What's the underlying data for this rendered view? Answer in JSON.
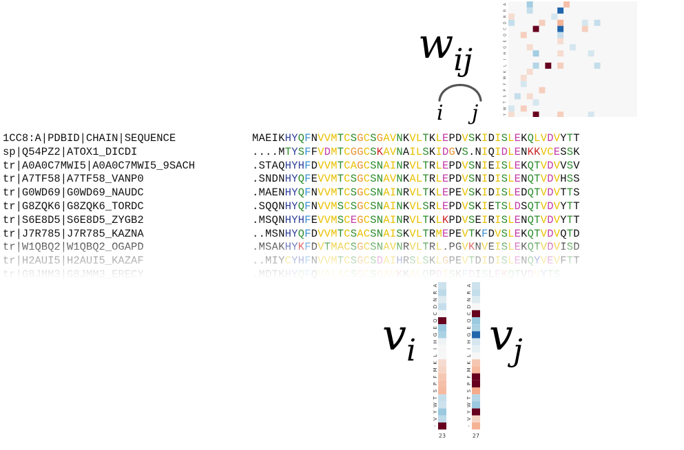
{
  "msa": {
    "rows": [
      {
        "id": "1CC8:A|PDBID|CHAIN|SEQUENCE",
        "seq": "MAEIKHYQFNVVMTCSGCSGAVNKVLTKLEPDVSKIDISLEKQLVDVYTT"
      },
      {
        "id": "sp|Q54PZ2|ATOX1_DICDI",
        "seq": "....MTYSFFVDMTCGGCSKAVNAILSKIDGVS.NIQIDLENKKVCESSK"
      },
      {
        "id": "tr|A0A0C7MWI5|A0A0C7MWI5_9SACH",
        "seq": ".STAQHYHFDVVMTCAGCSNAINRVLTRLEPDVSNIEISLEKQTVDVVSV"
      },
      {
        "id": "tr|A7TF58|A7TF58_VANP0",
        "seq": ".SNDNHYQFEVVMTCSGCSNAVNKALTRLEPDVSNIDISLENQTVDVHSS"
      },
      {
        "id": "tr|G0WD69|G0WD69_NAUDC",
        "seq": ".MAENHYQFNVVMTCSGCSNAINRVLTKLEPEVSKIDISLEDQTVDVTTS"
      },
      {
        "id": "tr|G8ZQK6|G8ZQK6_TORDC",
        "seq": ".SQQNHYQFNVVMSCSGCSNAINKVLSRLEPDVSKIETSLDSQTVDVYTT"
      },
      {
        "id": "tr|S6E8D5|S6E8D5_ZYGB2",
        "seq": ".MSQNHYHFEVVMSCEGCSNAINRVLTKLKPDVSEIRISLENQTVDVYTT"
      },
      {
        "id": "tr|J7R785|J7R785_KAZNA",
        "seq": "..MSNHYQFDVVMTCSACSNAISKVLTRMEPEVTKFDVSLEKQTVDVQTD"
      },
      {
        "id": "tr|W1QBQ2|W1QBQ2_OGAPD",
        "seq": ".MSAKHYKFDVTMACSGCSNAVNRVLTRL.PGVKNVEISLEKQTVDVISD"
      },
      {
        "id": "tr|H2AUI5|H2AUI5_KAZAF",
        "seq": "..MIYCYHFNVVMTCSGCSDAIHRSLSKLGPEVTDIDISLENQYVEVFTT"
      },
      {
        "id": "tr|G8JMM3|G8JMM3_ERECY",
        "seq": ".MDTKHYQFQVALACSGCSGAVKKALQPDISKFDISLEKQTVDVYTS"
      }
    ]
  },
  "colors": {
    "hydrophobic": "#e8c000",
    "cysteine": "#e8c000",
    "polar": "#2a8a2a",
    "positive": "#cc2222",
    "negative": "#cc2222",
    "aromatic": "#3388cc",
    "default": "#111111"
  },
  "labels": {
    "w": "w",
    "w_sub": "ij",
    "v_i": "v",
    "v_i_sub": "i",
    "v_j": "v",
    "v_j_sub": "j",
    "pos_i": "i",
    "pos_j": "j",
    "col_i_num": "23",
    "col_j_num": "27"
  },
  "alphabet": [
    "A",
    "R",
    "N",
    "D",
    "C",
    "Q",
    "E",
    "G",
    "H",
    "I",
    "L",
    "K",
    "M",
    "F",
    "P",
    "S",
    "T",
    "W",
    "Y",
    "V",
    "-"
  ],
  "profile_i": [
    0.25,
    0.35,
    0.15,
    0.3,
    0.0,
    -0.95,
    0.55,
    0.45,
    0.05,
    0.0,
    0.0,
    -0.2,
    -0.25,
    -0.35,
    -0.4,
    -0.45,
    0.3,
    0.25,
    0.55,
    0.35,
    -0.95
  ],
  "profile_j": [
    0.25,
    0.3,
    0.15,
    0.0,
    -0.95,
    0.55,
    0.45,
    0.6,
    0.2,
    0.1,
    0.0,
    -0.35,
    -0.45,
    -0.85,
    -0.75,
    -0.55,
    0.4,
    0.55,
    -0.9,
    -0.25,
    -0.5
  ],
  "w_matrix_nonzero": [
    [
      0,
      3,
      0.5
    ],
    [
      0,
      9,
      -0.4
    ],
    [
      1,
      3,
      0.3
    ],
    [
      1,
      8,
      0.6
    ],
    [
      2,
      0,
      -0.2
    ],
    [
      2,
      7,
      0.2
    ],
    [
      3,
      0,
      0.3
    ],
    [
      3,
      5,
      -0.3
    ],
    [
      3,
      8,
      -0.5
    ],
    [
      3,
      12,
      0.2
    ],
    [
      3,
      14,
      0.3
    ],
    [
      4,
      4,
      -0.9
    ],
    [
      4,
      8,
      0.9
    ],
    [
      4,
      12,
      -0.3
    ],
    [
      5,
      2,
      -0.3
    ],
    [
      5,
      8,
      0.3
    ],
    [
      6,
      8,
      -0.2
    ],
    [
      7,
      3,
      -0.2
    ],
    [
      7,
      10,
      0.2
    ],
    [
      8,
      4,
      0.5
    ],
    [
      8,
      8,
      -0.2
    ],
    [
      8,
      13,
      0.2
    ],
    [
      10,
      4,
      0.4
    ],
    [
      10,
      6,
      -0.8
    ],
    [
      10,
      8,
      -0.3
    ],
    [
      10,
      14,
      0.3
    ],
    [
      11,
      3,
      -0.2
    ],
    [
      12,
      2,
      -0.2
    ],
    [
      13,
      2,
      0.2
    ],
    [
      14,
      5,
      -0.3
    ],
    [
      15,
      1,
      0.3
    ],
    [
      15,
      3,
      -0.2
    ],
    [
      16,
      4,
      0.2
    ],
    [
      17,
      0,
      0.2
    ],
    [
      17,
      2,
      -0.3
    ],
    [
      18,
      0,
      -0.2
    ],
    [
      18,
      4,
      -0.8
    ],
    [
      18,
      8,
      -0.3
    ],
    [
      18,
      13,
      0.2
    ],
    [
      19,
      1,
      0.2
    ],
    [
      19,
      8,
      -0.3
    ],
    [
      20,
      5,
      -0.2
    ]
  ]
}
